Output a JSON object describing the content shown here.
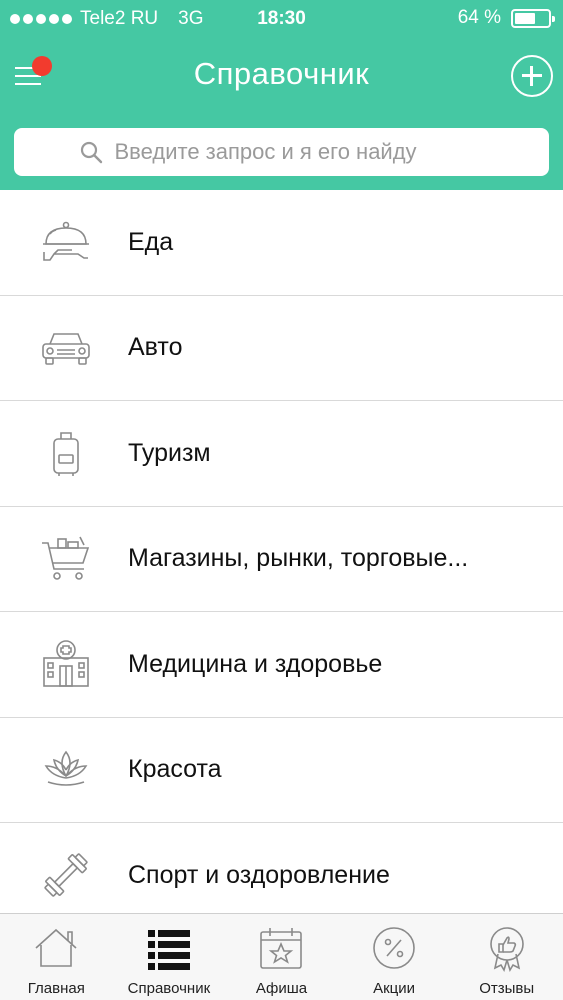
{
  "status_bar": {
    "carrier": "Tele2 RU",
    "network": "3G",
    "time": "18:30",
    "battery": "64 %",
    "battery_level_percent": 64
  },
  "header": {
    "title": "Справочник",
    "search_placeholder": "Введите запрос и я его найду"
  },
  "categories": [
    {
      "label": "Еда",
      "icon": "food-cloche-icon"
    },
    {
      "label": "Авто",
      "icon": "car-icon"
    },
    {
      "label": "Туризм",
      "icon": "suitcase-icon"
    },
    {
      "label": "Магазины, рынки, торговые...",
      "icon": "shopping-cart-icon"
    },
    {
      "label": "Медицина и здоровье",
      "icon": "hospital-icon"
    },
    {
      "label": "Красота",
      "icon": "lotus-icon"
    },
    {
      "label": "Спорт и оздоровление",
      "icon": "dumbbell-icon"
    }
  ],
  "tabs": [
    {
      "label": "Главная",
      "icon": "house-icon",
      "active": false
    },
    {
      "label": "Справочник",
      "icon": "list-icon",
      "active": true
    },
    {
      "label": "Афиша",
      "icon": "calendar-star-icon",
      "active": false
    },
    {
      "label": "Акции",
      "icon": "percent-icon",
      "active": false
    },
    {
      "label": "Отзывы",
      "icon": "thumbs-up-icon",
      "active": false
    }
  ],
  "colors": {
    "brand": "#45c8a3",
    "badge": "#f23b2e",
    "icon_gray": "#8a8a8a"
  }
}
